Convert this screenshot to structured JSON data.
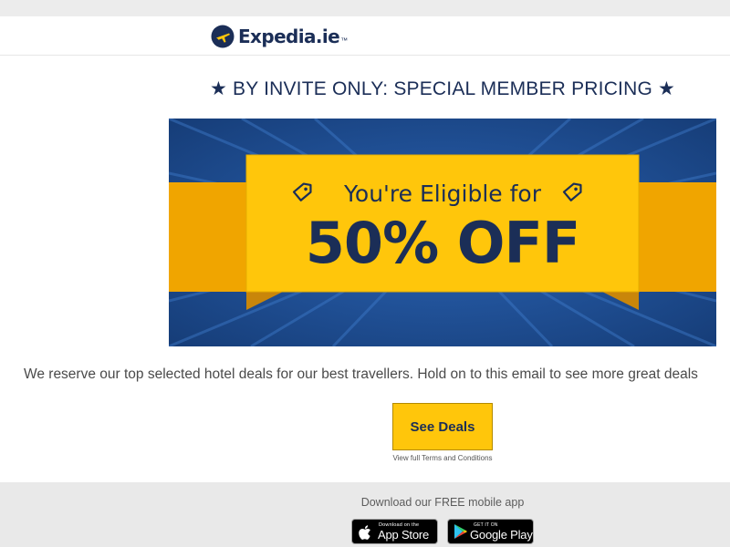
{
  "header": {
    "logo_text": "Expedia.ie",
    "logo_trademark": "™"
  },
  "headline": "★ BY INVITE ONLY: SPECIAL MEMBER PRICING ★",
  "banner": {
    "line1": "You're Eligible for",
    "line2": "50% OFF",
    "colors": {
      "blue": "#1d4a8f",
      "yellow": "#ffc60b",
      "navy": "#1b2e57"
    }
  },
  "body_text": "We reserve our top selected hotel deals for our best travellers. Hold on to this email to see more great deals",
  "cta": {
    "label": "See Deals",
    "terms": "View full Terms and Conditions"
  },
  "footer": {
    "app_text": "Download our FREE mobile app",
    "app_store": {
      "small": "Download on the",
      "big": "App Store"
    },
    "google_play": {
      "small": "GET IT ON",
      "big": "Google Play"
    }
  }
}
